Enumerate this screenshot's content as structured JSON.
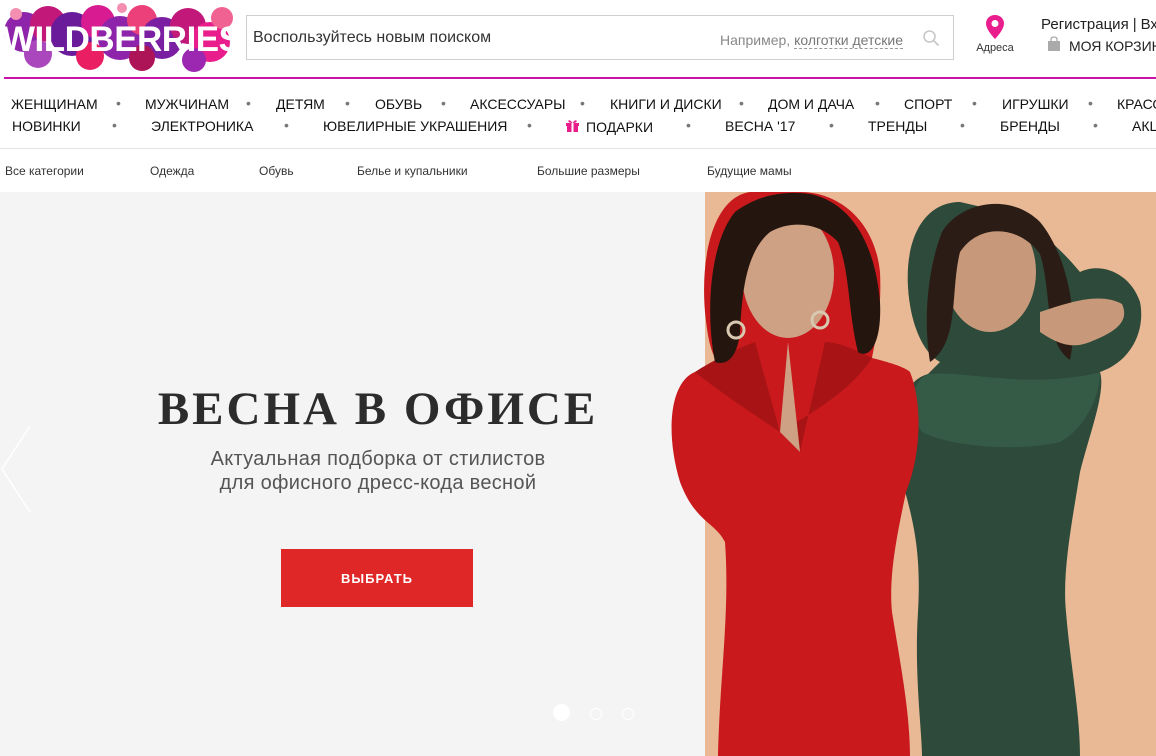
{
  "header": {
    "logo_text": "WILDBERRIES",
    "search": {
      "placeholder": "Воспользуйтесь новым поиском",
      "hint_prefix": "Например,",
      "hint_link": "колготки детские"
    },
    "address_label": "Адреса",
    "register_label": "Регистрация",
    "auth_separator": "|",
    "login_label": "Вход",
    "cart_label": "МОЯ КОРЗИНА"
  },
  "nav": {
    "row1": [
      "ЖЕНЩИНАМ",
      "МУЖЧИНАМ",
      "ДЕТЯМ",
      "ОБУВЬ",
      "АКСЕССУАРЫ",
      "КНИГИ И ДИСКИ",
      "ДОМ И ДАЧА",
      "СПОРТ",
      "ИГРУШКИ",
      "КРАСОТА"
    ],
    "row2": [
      "НОВИНКИ",
      "ЭЛЕКТРОНИКА",
      "ЮВЕЛИРНЫЕ УКРАШЕНИЯ",
      "ПОДАРКИ",
      "ВЕСНА '17",
      "ТРЕНДЫ",
      "БРЕНДЫ",
      "АКЦИИ"
    ],
    "separator": "•"
  },
  "subnav": [
    "Все категории",
    "Одежда",
    "Обувь",
    "Белье и купальники",
    "Большие размеры",
    "Будущие мамы"
  ],
  "hero": {
    "title": "ВЕСНА В ОФИСЕ",
    "subtitle_line1": "Актуальная подборка от стилистов",
    "subtitle_line2": "для офисного дресс-кода весной",
    "button_label": "ВЫБРАТЬ",
    "slide_count": 3,
    "active_slide": 1
  },
  "colors": {
    "brand_pink": "#cb11ab",
    "logo_purple": "#7b1fa2",
    "cta_red": "#e02727",
    "hero_left_bg": "#f4f4f4",
    "hero_right_bg": "#e9b996"
  },
  "icons": {
    "search": "search-icon",
    "address": "map-pin-icon",
    "cart": "shopping-bag-icon",
    "gift": "gift-icon",
    "carousel_prev": "chevron-left-icon"
  }
}
